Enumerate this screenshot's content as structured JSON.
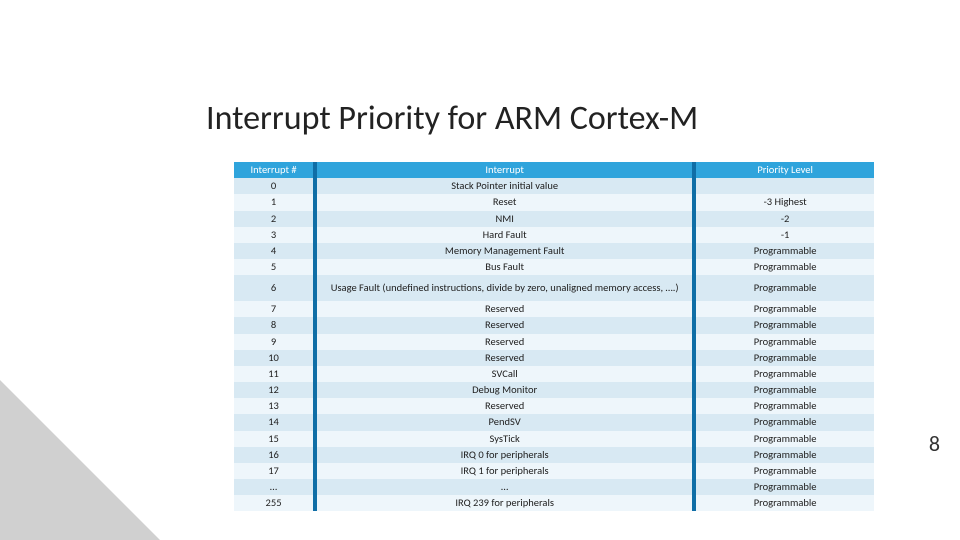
{
  "title": "Interrupt Priority for ARM Cortex-M",
  "page_number": "8",
  "table": {
    "headers": {
      "num": "Interrupt #",
      "desc": "Interrupt",
      "prio": "Priority Level"
    },
    "rows": [
      {
        "num": "0",
        "desc": "Stack Pointer initial value",
        "prio": ""
      },
      {
        "num": "1",
        "desc": "Reset",
        "prio": "-3 Highest"
      },
      {
        "num": "2",
        "desc": "NMI",
        "prio": "-2"
      },
      {
        "num": "3",
        "desc": "Hard Fault",
        "prio": "-1"
      },
      {
        "num": "4",
        "desc": "Memory Management Fault",
        "prio": "Programmable"
      },
      {
        "num": "5",
        "desc": "Bus Fault",
        "prio": "Programmable"
      },
      {
        "num": "6",
        "desc": "Usage Fault (undefined instructions, divide by zero, unaligned memory access, ….)",
        "prio": "Programmable",
        "tall": true
      },
      {
        "num": "7",
        "desc": "Reserved",
        "prio": "Programmable"
      },
      {
        "num": "8",
        "desc": "Reserved",
        "prio": "Programmable"
      },
      {
        "num": "9",
        "desc": "Reserved",
        "prio": "Programmable"
      },
      {
        "num": "10",
        "desc": "Reserved",
        "prio": "Programmable"
      },
      {
        "num": "11",
        "desc": "SVCall",
        "prio": "Programmable"
      },
      {
        "num": "12",
        "desc": "Debug Monitor",
        "prio": "Programmable"
      },
      {
        "num": "13",
        "desc": "Reserved",
        "prio": "Programmable"
      },
      {
        "num": "14",
        "desc": "PendSV",
        "prio": "Programmable"
      },
      {
        "num": "15",
        "desc": "SysTick",
        "prio": "Programmable"
      },
      {
        "num": "16",
        "desc": "IRQ 0 for peripherals",
        "prio": "Programmable"
      },
      {
        "num": "17",
        "desc": "IRQ 1 for peripherals",
        "prio": "Programmable"
      },
      {
        "num": "…",
        "desc": "…",
        "prio": "Programmable"
      },
      {
        "num": "255",
        "desc": "IRQ 239 for peripherals",
        "prio": "Programmable"
      }
    ]
  }
}
